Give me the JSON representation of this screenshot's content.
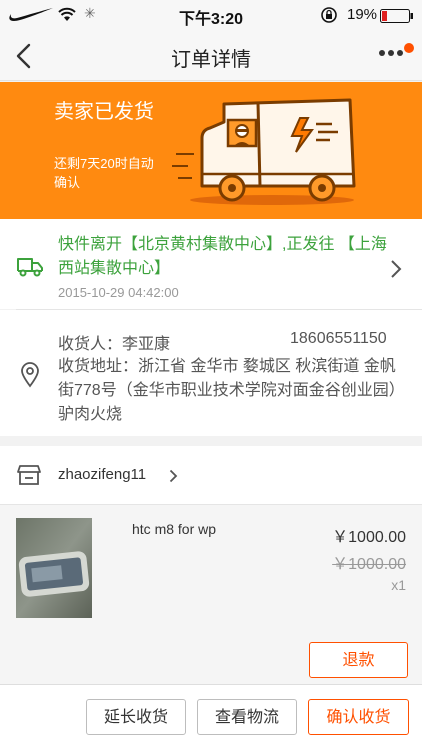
{
  "status_bar": {
    "time": "下午3:20",
    "battery": "19%",
    "icons": [
      "swoosh-logo",
      "wifi-icon",
      "loading-icon",
      "rotation-lock-icon",
      "battery-icon"
    ]
  },
  "nav": {
    "title": "订单详情",
    "icons": [
      "back-icon",
      "more-icon"
    ]
  },
  "banner": {
    "title": "卖家已发货",
    "subtitle": "还剩7天20时自动确认",
    "color": "#ff8a10"
  },
  "logistics": {
    "text": "快件离开【北京黄村集散中心】,正发往 【上海西站集散中心】",
    "time": "2015-10-29 04:42:00",
    "color": "#3ca23c"
  },
  "receiver": {
    "name": "收货人：李亚康",
    "phone": "18606551150",
    "address": "收货地址：浙江省 金华市 婺城区 秋滨街道 金帆街778号（金华市职业技术学院对面金谷创业园）驴肉火烧"
  },
  "seller": {
    "name": "zhaozifeng11"
  },
  "product": {
    "name": "htc m8 for wp",
    "price": "￥1000.00",
    "original_price": "￥1000.00",
    "quantity": "x1"
  },
  "buttons": {
    "refund": "退款",
    "extend": "延长收货",
    "logistics": "查看物流",
    "confirm": "确认收货"
  },
  "accent_color": "#ff5000"
}
